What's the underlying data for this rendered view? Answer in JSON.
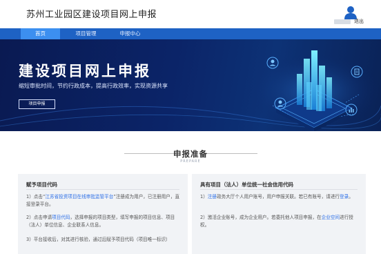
{
  "header": {
    "site_title": "苏州工业园区建设项目网上申报",
    "logout_label": "退出"
  },
  "nav": {
    "items": [
      {
        "label": "首页",
        "active": true
      },
      {
        "label": "项目管理",
        "active": false
      },
      {
        "label": "申报中心",
        "active": false
      }
    ]
  },
  "hero": {
    "title": "建设项目网上申报",
    "subtitle": "缩短审批时间，节约行政成本，提高行政效率，实现资源共享",
    "button_label": "项目申报"
  },
  "prepare": {
    "title": "申报准备",
    "subtitle": "PREPARE"
  },
  "left_panel": {
    "title": "赋予项目代码",
    "p1": {
      "a": "1）点击“",
      "link": "江苏省投资项目在线审批监管平台",
      "b": "”注册成为用户，已注册用户，直接登录平台。"
    },
    "p2": {
      "a": "2）点击申请",
      "link": "项目代码",
      "b": "，选择申报的项目类型，填写申报的项目信息、项目（法人）单位信息、企业联系人信息。"
    },
    "p3": {
      "a": "3）平台接收后，对其进行核验，通过后赋予项目代码（项目唯一标识）"
    }
  },
  "right_panel": {
    "title": "具有项目（法人）单位统一社会信用代码",
    "p1": {
      "a": "1）",
      "link": "注册",
      "b": "政务大厅个人用户账号，用户申报关联。若已有账号，请进行",
      "link2": "登录",
      "c": "。"
    },
    "p2": {
      "a": "2）激活企业账号，成为企业用户。若委托他人项目申报，在",
      "link": "企业空间",
      "b": "进行授权。"
    }
  },
  "colors": {
    "nav_bg": "#1e62c4",
    "nav_active": "#3c8ff0",
    "hero_bg": "#0b2468",
    "link": "#2b6ee6",
    "panel_bg": "#f1f3f6"
  }
}
